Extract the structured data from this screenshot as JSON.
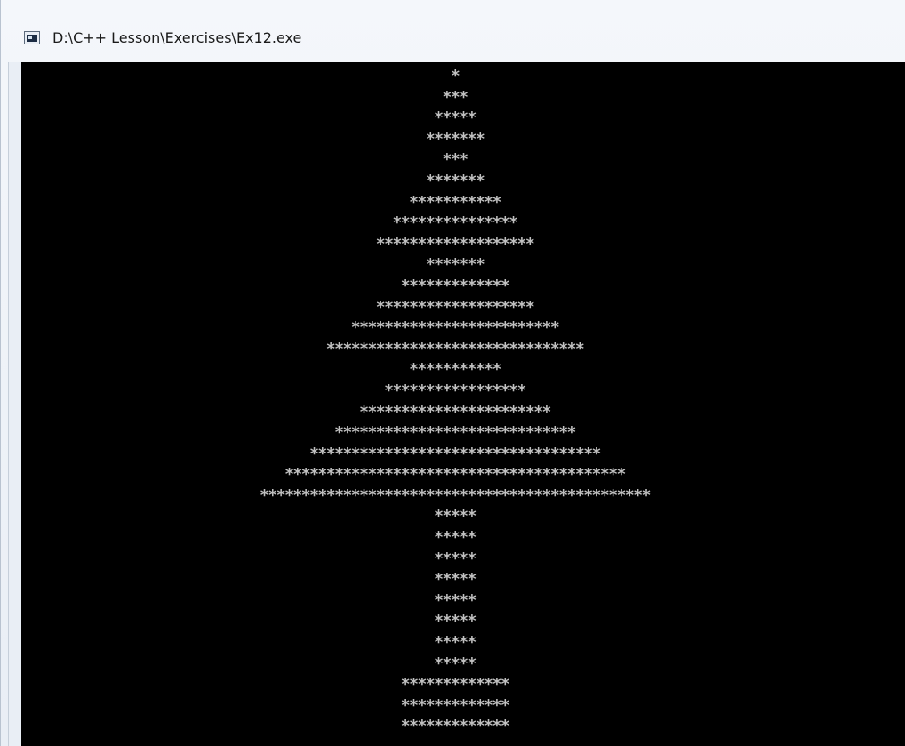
{
  "window": {
    "title": "D:\\C++ Lesson\\Exercises\\Ex12.exe",
    "icon": "console-app-icon"
  },
  "console": {
    "background": "#000000",
    "text_color": "#c0c0c0",
    "lines": [
      "*",
      "***",
      "*****",
      "*******",
      "***",
      "*******",
      "***********",
      "***************",
      "*******************",
      "*******",
      "*************",
      "*******************",
      "*************************",
      "*******************************",
      "***********",
      "*****************",
      "***********************",
      "*****************************",
      "***********************************",
      "*****************************************",
      "***********************************************",
      "*****",
      "*****",
      "*****",
      "*****",
      "*****",
      "*****",
      "*****",
      "*****",
      "*************",
      "*************",
      "*************"
    ]
  }
}
